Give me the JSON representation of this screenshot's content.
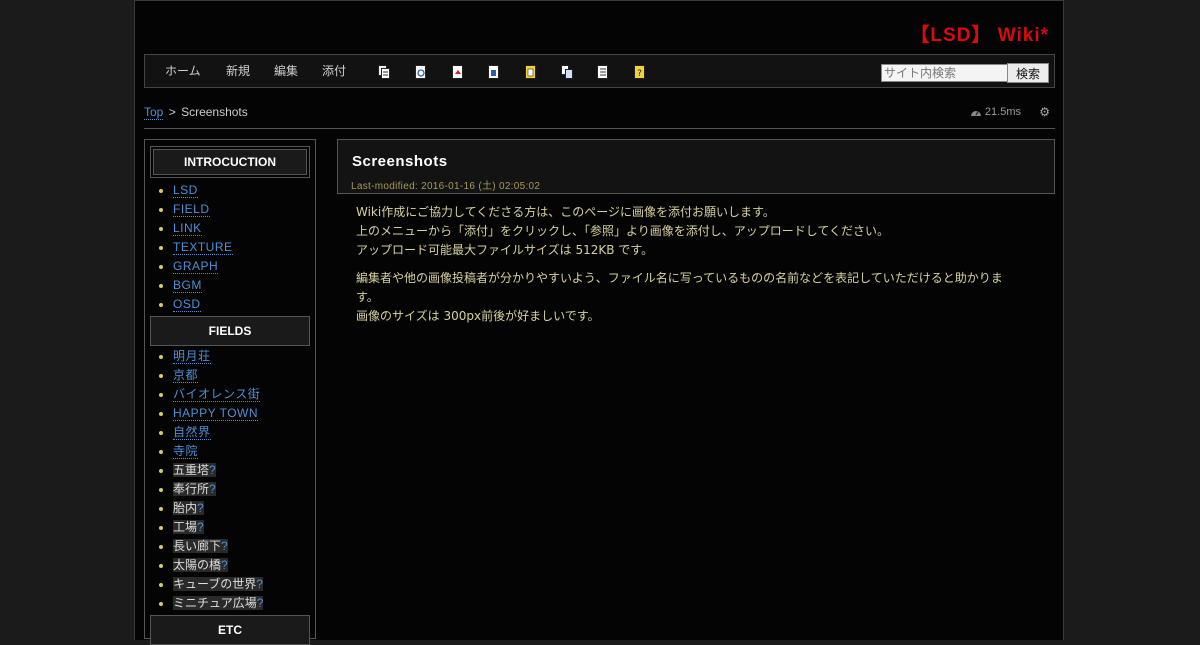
{
  "site": {
    "title": "【LSD】 Wiki*"
  },
  "nav": {
    "items": [
      {
        "label": "ホーム"
      },
      {
        "label": "新規"
      },
      {
        "label": "編集"
      },
      {
        "label": "添付"
      }
    ],
    "tool_icons": [
      "diff-icon",
      "backup-icon",
      "reload-icon",
      "freeze-icon",
      "list-icon",
      "copy-icon",
      "recent-icon",
      "help-icon"
    ],
    "search": {
      "placeholder": "サイト内検索",
      "value": "",
      "button_label": "検索"
    }
  },
  "breadcrumb": {
    "top": "Top",
    "separator": ">",
    "current": "Screenshots"
  },
  "perf": {
    "time": "21.5ms"
  },
  "sidebar": {
    "sections": [
      {
        "heading": "INTROCUCTION",
        "items": [
          {
            "label": "LSD",
            "exists": true
          },
          {
            "label": "FIELD",
            "exists": true
          },
          {
            "label": "LINK",
            "exists": true
          },
          {
            "label": "TEXTURE",
            "exists": true
          },
          {
            "label": "GRAPH",
            "exists": true
          },
          {
            "label": "BGM",
            "exists": true
          },
          {
            "label": "OSD",
            "exists": true
          }
        ]
      },
      {
        "heading": "FIELDS",
        "items": [
          {
            "label": "明月荘",
            "exists": true
          },
          {
            "label": "京都",
            "exists": true
          },
          {
            "label": "バイオレンス街",
            "exists": true
          },
          {
            "label": "HAPPY TOWN",
            "exists": true
          },
          {
            "label": "自然界",
            "exists": true
          },
          {
            "label": "寺院",
            "exists": true
          },
          {
            "label": "五重塔",
            "exists": false
          },
          {
            "label": "奉行所",
            "exists": false
          },
          {
            "label": "胎内",
            "exists": false
          },
          {
            "label": "工場",
            "exists": false
          },
          {
            "label": "長い廊下",
            "exists": false
          },
          {
            "label": "太陽の橋",
            "exists": false
          },
          {
            "label": "キューブの世界",
            "exists": false
          },
          {
            "label": "ミニチュア広場",
            "exists": false
          }
        ]
      },
      {
        "heading": "ETC",
        "items": []
      }
    ],
    "missing_marker": "?"
  },
  "content": {
    "title": "Screenshots",
    "last_modified": "Last-modified: 2016-01-16 (土) 02:05:02",
    "paragraphs": [
      [
        "Wiki作成にご協力してくださる方は、このページに画像を添付お願いします。",
        "上のメニューから「添付」をクリックし、「参照」より画像を添付し、アップロードしてください。",
        "アップロード可能最大ファイルサイズは 512KB です。"
      ],
      [
        "編集者や他の画像投稿者が分かりやすいよう、ファイル名に写っているものの名前などを表記していただけると助かりま",
        "す。",
        "画像のサイズは 300px前後が好ましいです。"
      ]
    ]
  },
  "colors": {
    "title_red": "#d80c0c",
    "link_blue": "#4f8fd6",
    "body_text": "#d7d0a0",
    "background": "#040404"
  }
}
